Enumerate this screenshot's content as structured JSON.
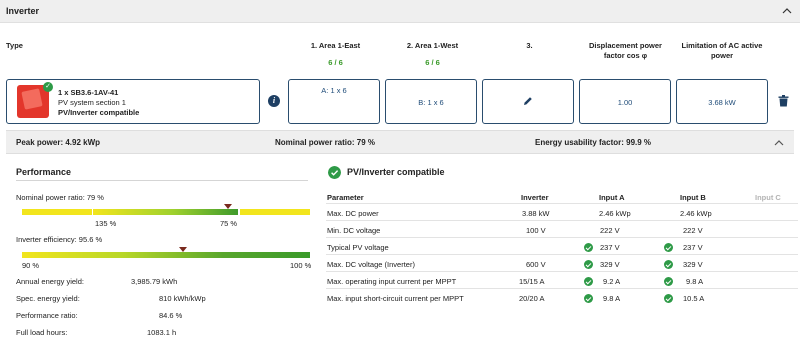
{
  "header": {
    "title": "Inverter"
  },
  "columns": {
    "type": "Type",
    "area1": {
      "title": "1. Area 1-East",
      "ratio": "6 / 6"
    },
    "area2": {
      "title": "2. Area 1-West",
      "ratio": "6 / 6"
    },
    "area3": {
      "title": "3."
    },
    "cosphi": {
      "line1": "Displacement power",
      "line2": "factor cos φ"
    },
    "aclimit": {
      "line1": "Limitation of AC active",
      "line2": "power"
    }
  },
  "inverter": {
    "name": "1 x SB3.6-1AV-41",
    "system": "PV system section 1",
    "status": "PV/Inverter compatible",
    "area1_value": "A: 1 x 6",
    "area2_value": "B: 1 x 6",
    "cosphi_value": "1.00",
    "aclimit_value": "3.68 kW"
  },
  "summary": {
    "peak_power": "Peak power: 4.92 kWp",
    "nominal_ratio": "Nominal power ratio: 79 %",
    "energy_usability": "Energy usability factor: 99.9 %"
  },
  "performance": {
    "title": "Performance",
    "nominal_label": "Nominal power ratio: 79 %",
    "nominal_value_pct": 79,
    "nominal_scale_low": "135 %",
    "nominal_scale_high": "75 %",
    "efficiency_label": "Inverter efficiency: 95.6 %",
    "efficiency_value_pct": 95.6,
    "efficiency_scale_low": "90 %",
    "efficiency_scale_high": "100 %",
    "stats": [
      {
        "label": "Annual energy yield:",
        "value": "3,985.79 kWh"
      },
      {
        "label": "Spec. energy yield:",
        "value": "810 kWh/kWp"
      },
      {
        "label": "Performance ratio:",
        "value": "84.6 %"
      },
      {
        "label": "Full load hours:",
        "value": "1083.1 h"
      }
    ]
  },
  "compat": {
    "title": "PV/Inverter compatible",
    "headers": {
      "parameter": "Parameter",
      "inverter": "Inverter",
      "inputA": "Input A",
      "inputB": "Input B",
      "inputC": "Input C"
    },
    "rows": [
      {
        "param": "Max. DC power",
        "inv": "3.88 kW",
        "a": "2.46 kWp",
        "b": "2.46 kWp",
        "a_ok": false,
        "b_ok": false
      },
      {
        "param": "Min. DC voltage",
        "inv": "100 V",
        "a": "222 V",
        "b": "222 V",
        "a_ok": false,
        "b_ok": false
      },
      {
        "param": "Typical PV voltage",
        "inv": "",
        "a": "237 V",
        "b": "237 V",
        "a_ok": true,
        "b_ok": true
      },
      {
        "param": "Max. DC voltage (Inverter)",
        "inv": "600 V",
        "a": "329 V",
        "b": "329 V",
        "a_ok": true,
        "b_ok": true
      },
      {
        "param": "Max. operating input current per MPPT",
        "inv": "15/15 A",
        "a": "9.2 A",
        "b": "9.8 A",
        "a_ok": true,
        "b_ok": true
      },
      {
        "param": "Max. input short-circuit current per MPPT",
        "inv": "20/20 A",
        "a": "9.8 A",
        "b": "10.5 A",
        "a_ok": true,
        "b_ok": true
      }
    ]
  },
  "colors": {
    "accent": "#1e4b78",
    "ok": "#2e9a47",
    "ratio": "#3a9a2a",
    "marker": "#7a2a1e"
  }
}
